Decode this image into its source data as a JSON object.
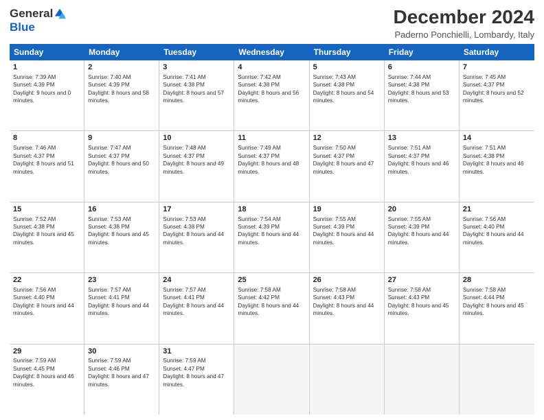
{
  "logo": {
    "general": "General",
    "blue": "Blue"
  },
  "title": "December 2024",
  "location": "Paderno Ponchielli, Lombardy, Italy",
  "days": [
    "Sunday",
    "Monday",
    "Tuesday",
    "Wednesday",
    "Thursday",
    "Friday",
    "Saturday"
  ],
  "weeks": [
    [
      {
        "day": 1,
        "sunrise": "7:39 AM",
        "sunset": "4:39 PM",
        "daylight": "9 hours and 0 minutes."
      },
      {
        "day": 2,
        "sunrise": "7:40 AM",
        "sunset": "4:39 PM",
        "daylight": "8 hours and 58 minutes."
      },
      {
        "day": 3,
        "sunrise": "7:41 AM",
        "sunset": "4:38 PM",
        "daylight": "8 hours and 57 minutes."
      },
      {
        "day": 4,
        "sunrise": "7:42 AM",
        "sunset": "4:38 PM",
        "daylight": "8 hours and 56 minutes."
      },
      {
        "day": 5,
        "sunrise": "7:43 AM",
        "sunset": "4:38 PM",
        "daylight": "8 hours and 54 minutes."
      },
      {
        "day": 6,
        "sunrise": "7:44 AM",
        "sunset": "4:38 PM",
        "daylight": "8 hours and 53 minutes."
      },
      {
        "day": 7,
        "sunrise": "7:45 AM",
        "sunset": "4:37 PM",
        "daylight": "8 hours and 52 minutes."
      }
    ],
    [
      {
        "day": 8,
        "sunrise": "7:46 AM",
        "sunset": "4:37 PM",
        "daylight": "8 hours and 51 minutes."
      },
      {
        "day": 9,
        "sunrise": "7:47 AM",
        "sunset": "4:37 PM",
        "daylight": "8 hours and 50 minutes."
      },
      {
        "day": 10,
        "sunrise": "7:48 AM",
        "sunset": "4:37 PM",
        "daylight": "8 hours and 49 minutes."
      },
      {
        "day": 11,
        "sunrise": "7:49 AM",
        "sunset": "4:37 PM",
        "daylight": "8 hours and 48 minutes."
      },
      {
        "day": 12,
        "sunrise": "7:50 AM",
        "sunset": "4:37 PM",
        "daylight": "8 hours and 47 minutes."
      },
      {
        "day": 13,
        "sunrise": "7:51 AM",
        "sunset": "4:37 PM",
        "daylight": "8 hours and 46 minutes."
      },
      {
        "day": 14,
        "sunrise": "7:51 AM",
        "sunset": "4:38 PM",
        "daylight": "8 hours and 46 minutes."
      }
    ],
    [
      {
        "day": 15,
        "sunrise": "7:52 AM",
        "sunset": "4:38 PM",
        "daylight": "8 hours and 45 minutes."
      },
      {
        "day": 16,
        "sunrise": "7:53 AM",
        "sunset": "4:38 PM",
        "daylight": "8 hours and 45 minutes."
      },
      {
        "day": 17,
        "sunrise": "7:53 AM",
        "sunset": "4:38 PM",
        "daylight": "8 hours and 44 minutes."
      },
      {
        "day": 18,
        "sunrise": "7:54 AM",
        "sunset": "4:39 PM",
        "daylight": "8 hours and 44 minutes."
      },
      {
        "day": 19,
        "sunrise": "7:55 AM",
        "sunset": "4:39 PM",
        "daylight": "8 hours and 44 minutes."
      },
      {
        "day": 20,
        "sunrise": "7:55 AM",
        "sunset": "4:39 PM",
        "daylight": "8 hours and 44 minutes."
      },
      {
        "day": 21,
        "sunrise": "7:56 AM",
        "sunset": "4:40 PM",
        "daylight": "8 hours and 44 minutes."
      }
    ],
    [
      {
        "day": 22,
        "sunrise": "7:56 AM",
        "sunset": "4:40 PM",
        "daylight": "8 hours and 44 minutes."
      },
      {
        "day": 23,
        "sunrise": "7:57 AM",
        "sunset": "4:41 PM",
        "daylight": "8 hours and 44 minutes."
      },
      {
        "day": 24,
        "sunrise": "7:57 AM",
        "sunset": "4:41 PM",
        "daylight": "8 hours and 44 minutes."
      },
      {
        "day": 25,
        "sunrise": "7:58 AM",
        "sunset": "4:42 PM",
        "daylight": "8 hours and 44 minutes."
      },
      {
        "day": 26,
        "sunrise": "7:58 AM",
        "sunset": "4:43 PM",
        "daylight": "8 hours and 44 minutes."
      },
      {
        "day": 27,
        "sunrise": "7:58 AM",
        "sunset": "4:43 PM",
        "daylight": "8 hours and 45 minutes."
      },
      {
        "day": 28,
        "sunrise": "7:58 AM",
        "sunset": "4:44 PM",
        "daylight": "8 hours and 45 minutes."
      }
    ],
    [
      {
        "day": 29,
        "sunrise": "7:59 AM",
        "sunset": "4:45 PM",
        "daylight": "8 hours and 46 minutes."
      },
      {
        "day": 30,
        "sunrise": "7:59 AM",
        "sunset": "4:46 PM",
        "daylight": "8 hours and 47 minutes."
      },
      {
        "day": 31,
        "sunrise": "7:59 AM",
        "sunset": "4:47 PM",
        "daylight": "8 hours and 47 minutes."
      },
      null,
      null,
      null,
      null
    ]
  ]
}
